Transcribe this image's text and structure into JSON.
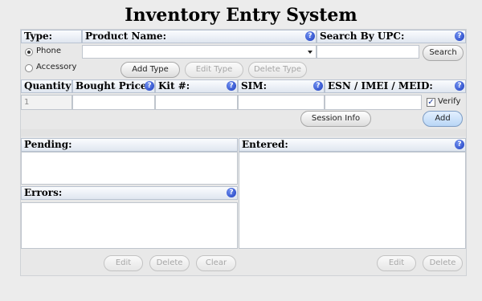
{
  "title": "Inventory Entry System",
  "type_section": {
    "header": "Type:",
    "options": [
      "Phone",
      "Accessory"
    ],
    "selected": "Phone"
  },
  "product": {
    "header": "Product Name:",
    "select_value": "",
    "add_label": "Add Type",
    "edit_label": "Edit Type",
    "delete_label": "Delete Type"
  },
  "upc": {
    "header": "Search By UPC:",
    "value": "",
    "search_label": "Search"
  },
  "entry_row": {
    "quantity_header": "Quantity:",
    "quantity_value": "1",
    "price_header": "Bought Price:",
    "kit_header": "Kit #:",
    "sim_header": "SIM:",
    "esn_header": "ESN / IMEI / MEID:",
    "verify_label": "Verify",
    "verify_checked": true,
    "check_mark": "✓"
  },
  "actions": {
    "session_info_label": "Session Info",
    "add_label": "Add"
  },
  "pending": {
    "header": "Pending:"
  },
  "errors": {
    "header": "Errors:"
  },
  "entered": {
    "header": "Entered:"
  },
  "bottom": {
    "left_edit": "Edit",
    "left_delete": "Delete",
    "left_clear": "Clear",
    "right_edit": "Edit",
    "right_delete": "Delete"
  },
  "help_glyph": "?"
}
